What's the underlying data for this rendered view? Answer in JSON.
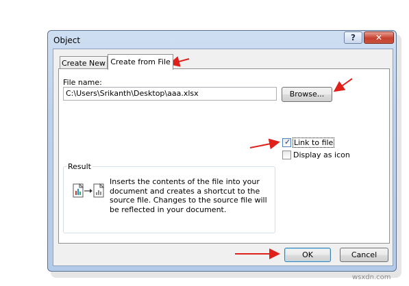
{
  "dialog": {
    "title": "Object",
    "help_label": "?",
    "close_label": "✕"
  },
  "tabs": [
    {
      "label": "Create New",
      "active": false
    },
    {
      "label": "Create from File",
      "active": true
    }
  ],
  "file": {
    "label": "File name:",
    "value": "C:\\Users\\Srikanth\\Desktop\\aaa.xlsx",
    "browse_label": "Browse..."
  },
  "options": {
    "link_label": "Link to file",
    "link_checked": true,
    "icon_label": "Display as icon",
    "icon_checked": false
  },
  "result": {
    "legend": "Result",
    "text": "Inserts the contents of the file into your document and creates a shortcut to the source file.  Changes to the source file will be reflected in your document."
  },
  "buttons": {
    "ok_label": "OK",
    "cancel_label": "Cancel"
  },
  "watermark": "wsxdn.com",
  "colors": {
    "annotation_arrow": "#e0201b",
    "title_bar": "#bcd2ec",
    "close_button": "#c5412f"
  }
}
